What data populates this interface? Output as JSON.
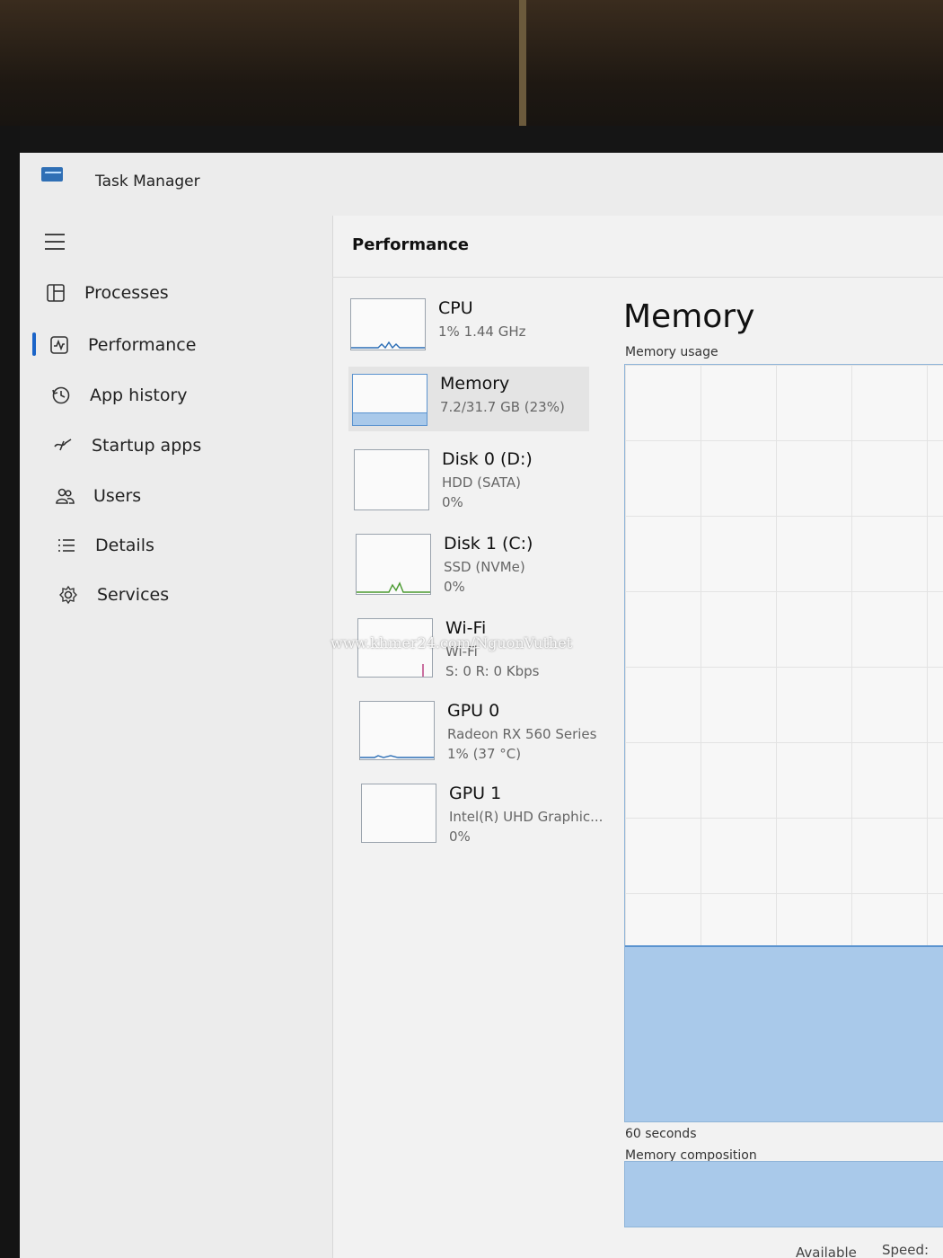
{
  "window": {
    "title": "Task Manager"
  },
  "nav": {
    "items": [
      {
        "label": "Processes",
        "icon": "processes-icon"
      },
      {
        "label": "Performance",
        "icon": "performance-icon",
        "selected": true
      },
      {
        "label": "App history",
        "icon": "app-history-icon"
      },
      {
        "label": "Startup apps",
        "icon": "startup-apps-icon"
      },
      {
        "label": "Users",
        "icon": "users-icon"
      },
      {
        "label": "Details",
        "icon": "details-icon"
      },
      {
        "label": "Services",
        "icon": "services-icon"
      }
    ]
  },
  "performance": {
    "title": "Performance",
    "resources": [
      {
        "name": "CPU",
        "line1": "1% 1.44 GHz",
        "line2": ""
      },
      {
        "name": "Memory",
        "line1": "7.2/31.7 GB (23%)",
        "line2": "",
        "selected": true,
        "usage_fraction": 0.23
      },
      {
        "name": "Disk 0 (D:)",
        "line1": "HDD (SATA)",
        "line2": "0%"
      },
      {
        "name": "Disk 1 (C:)",
        "line1": "SSD (NVMe)",
        "line2": "0%"
      },
      {
        "name": "Wi-Fi",
        "line1": "Wi-Fi",
        "line2": "S: 0 R: 0 Kbps"
      },
      {
        "name": "GPU 0",
        "line1": "Radeon RX 560 Series",
        "line2": "1% (37 °C)"
      },
      {
        "name": "GPU 1",
        "line1": "Intel(R) UHD Graphic...",
        "line2": "0%"
      }
    ]
  },
  "detail": {
    "title": "Memory",
    "usage_label": "Memory usage",
    "time_label": "60 seconds",
    "composition_label": "Memory composition",
    "available_label": "Available",
    "speed_label": "Speed:",
    "usage_fraction": 0.23
  },
  "watermark": "www.khmer24.com/NguonVuthet",
  "colors": {
    "accent": "#1a64c8",
    "graph_fill": "#a9c9ea",
    "graph_line": "#5a93cf"
  }
}
